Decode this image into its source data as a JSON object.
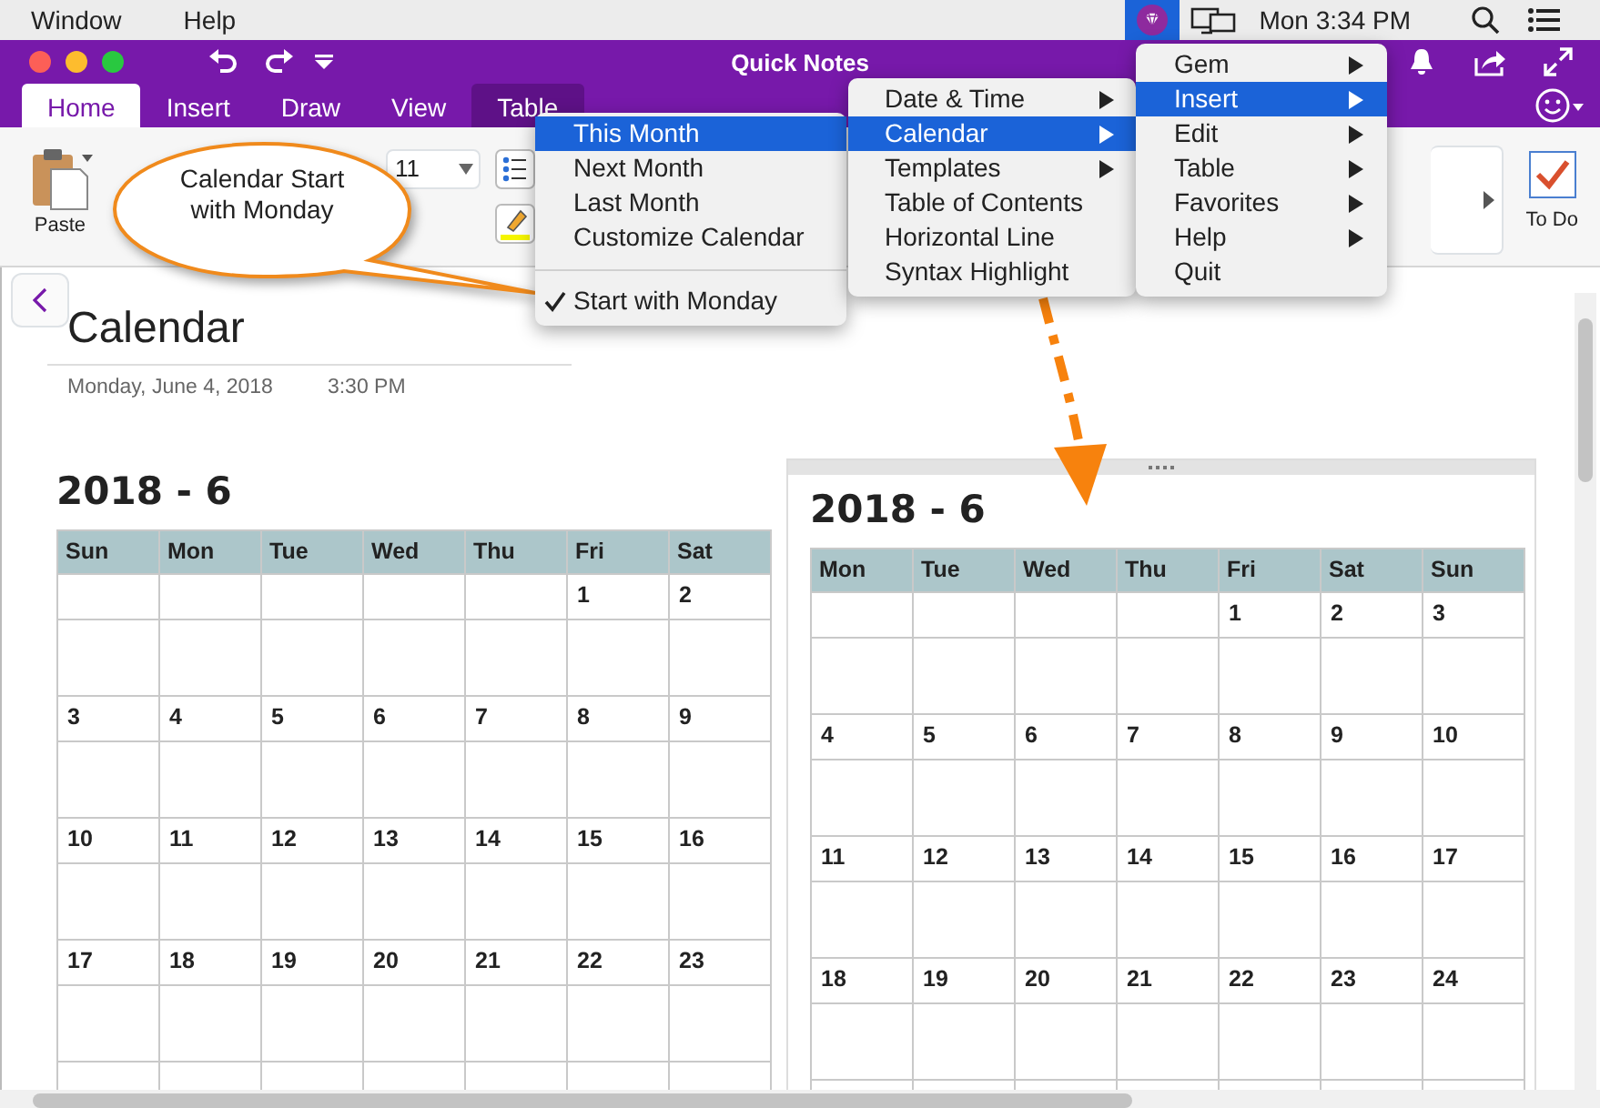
{
  "menubar": {
    "items": [
      "Window",
      "Help"
    ],
    "clock": "Mon 3:34 PM",
    "gem_selected": true
  },
  "window": {
    "title": "Quick Notes"
  },
  "tabs": [
    {
      "label": "Home",
      "selected": true
    },
    {
      "label": "Insert",
      "selected": false
    },
    {
      "label": "Draw",
      "selected": false
    },
    {
      "label": "View",
      "selected": false
    },
    {
      "label": "Table",
      "selected": false,
      "kind": "contextual"
    }
  ],
  "ribbon": {
    "paste_label": "Paste",
    "font_size": "11",
    "todo_label": "To Do",
    "todo_checked": true
  },
  "menus": [
    {
      "items": [
        {
          "kind": "item",
          "label": "This Month",
          "selected": true,
          "checked": false
        },
        {
          "kind": "item",
          "label": "Next Month",
          "selected": false,
          "checked": false
        },
        {
          "kind": "item",
          "label": "Last Month",
          "selected": false,
          "checked": false
        },
        {
          "kind": "item",
          "label": "Customize Calendar",
          "selected": false,
          "checked": false
        },
        {
          "kind": "separator"
        },
        {
          "kind": "item",
          "label": "Start with Monday",
          "selected": false,
          "checked": true
        }
      ]
    },
    {
      "items": [
        {
          "label": "Date & Time",
          "submenu": true,
          "selected": false
        },
        {
          "label": "Calendar",
          "submenu": true,
          "selected": true
        },
        {
          "label": "Templates",
          "submenu": true,
          "selected": false
        },
        {
          "label": "Table of Contents",
          "submenu": false,
          "selected": false
        },
        {
          "label": "Horizontal Line",
          "submenu": false,
          "selected": false
        },
        {
          "label": "Syntax Highlight",
          "submenu": false,
          "selected": false
        }
      ]
    },
    {
      "items": [
        {
          "label": "Gem",
          "submenu": true,
          "selected": false
        },
        {
          "label": "Insert",
          "submenu": true,
          "selected": true
        },
        {
          "label": "Edit",
          "submenu": true,
          "selected": false
        },
        {
          "label": "Table",
          "submenu": true,
          "selected": false
        },
        {
          "label": "Favorites",
          "submenu": true,
          "selected": false
        },
        {
          "label": "Help",
          "submenu": true,
          "selected": false
        },
        {
          "label": "Quit",
          "submenu": false,
          "selected": false
        }
      ]
    }
  ],
  "callout": {
    "text": "Calendar Start with Monday"
  },
  "page": {
    "title": "Calendar",
    "date": "Monday, June 4, 2018",
    "time": "3:30 PM"
  },
  "calendars": [
    {
      "title": "2018 - 6",
      "columns": [
        "Sun",
        "Mon",
        "Tue",
        "Wed",
        "Thu",
        "Fri",
        "Sat"
      ],
      "weeks": [
        [
          {
            "kind": "blank"
          },
          {
            "kind": "blank"
          },
          {
            "kind": "blank"
          },
          {
            "kind": "blank"
          },
          {
            "kind": "blank"
          },
          "1",
          "2"
        ],
        [
          "3",
          "4",
          "5",
          "6",
          "7",
          "8",
          "9"
        ],
        [
          "10",
          "11",
          "12",
          "13",
          "14",
          "15",
          "16"
        ],
        [
          "17",
          "18",
          "19",
          "20",
          "21",
          "22",
          "23"
        ]
      ]
    },
    {
      "title": "2018 - 6",
      "columns": [
        "Mon",
        "Tue",
        "Wed",
        "Thu",
        "Fri",
        "Sat",
        "Sun"
      ],
      "weeks": [
        [
          {
            "kind": "blank"
          },
          {
            "kind": "blank"
          },
          {
            "kind": "blank"
          },
          {
            "kind": "blank"
          },
          "1",
          "2",
          "3"
        ],
        [
          "4",
          "5",
          "6",
          "7",
          "8",
          "9",
          "10"
        ],
        [
          "11",
          "12",
          "13",
          "14",
          "15",
          "16",
          "17"
        ],
        [
          "18",
          "19",
          "20",
          "21",
          "22",
          "23",
          "24"
        ]
      ]
    }
  ]
}
